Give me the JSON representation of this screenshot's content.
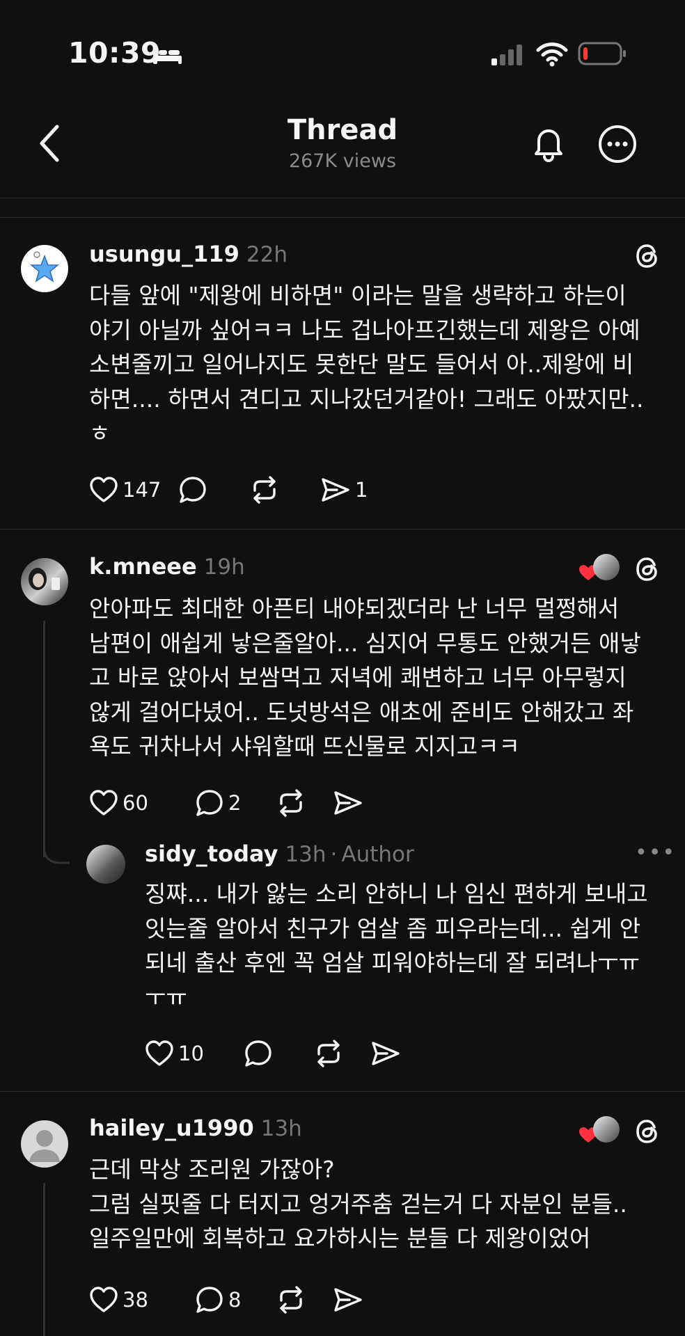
{
  "status": {
    "time": "10:39"
  },
  "header": {
    "title": "Thread",
    "views": "267K views"
  },
  "posts": [
    {
      "username": "usungu_119",
      "time": "22h",
      "text": "다들 앞에 \"제왕에 비하면\" 이라는 말을 생략하고 하는이\n야기 아닐까 싶어ㅋㅋ 나도 겁나아프긴했는데 제왕은 아예\n소변줄끼고 일어나지도 못한단 말도 들어서 아..제왕에 비\n하면.... 하면서 견디고 지나갔던거같아! 그래도 아팠지만..\nㅎ",
      "likes": "147",
      "replies": "",
      "shares": "1"
    },
    {
      "username": "k.mneee",
      "time": "19h",
      "text": "안아파도 최대한 아픈티 내야되겠더라 난 너무 멀쩡해서\n남편이 애쉽게 낳은줄알아... 심지어 무통도 안했거든 애낳\n고 바로 앉아서 보쌈먹고 저녁에 쾌변하고 너무 아무렇지\n않게 걸어다녔어.. 도넛방석은 애초에 준비도 안해갔고 좌\n욕도 귀차나서 샤워할때 뜨신물로 지지고ㅋㅋ",
      "likes": "60",
      "replies": "2",
      "shares": ""
    },
    {
      "username": "sidy_today",
      "time": "13h",
      "author_label": "Author",
      "text": "징쨔... 내가 앓는 소리 안하니 나 임신 편하게 보내고\n잇는줄 알아서 친구가 엄살 좀 피우라는데... 쉽게 안\n되네 출산 후엔 꼭 엄살 피워야하는데 잘 되려나ㅜㅠ\nㅜㅠ",
      "likes": "10",
      "replies": "",
      "shares": ""
    },
    {
      "username": "hailey_u1990",
      "time": "13h",
      "text": "근데 막상 조리원 가잖아?\n그럼 실핏줄 다 터지고 엉거주춤 걷는거 다 자분인 분들..\n일주일만에 회복하고 요가하시는 분들 다 제왕이었어",
      "likes": "38",
      "replies": "8",
      "shares": ""
    }
  ],
  "colors": {
    "background": "#101010",
    "text": "#f3f5f7",
    "muted": "#777777",
    "like_heart": "#ff3040",
    "battery_low": "#ff3b30"
  },
  "icons": [
    "bed-icon",
    "signal-icon",
    "wifi-icon",
    "battery-icon",
    "back-icon",
    "bell-icon",
    "more-icon",
    "threads-logo-icon",
    "heart-icon",
    "comment-icon",
    "repost-icon",
    "share-icon"
  ]
}
